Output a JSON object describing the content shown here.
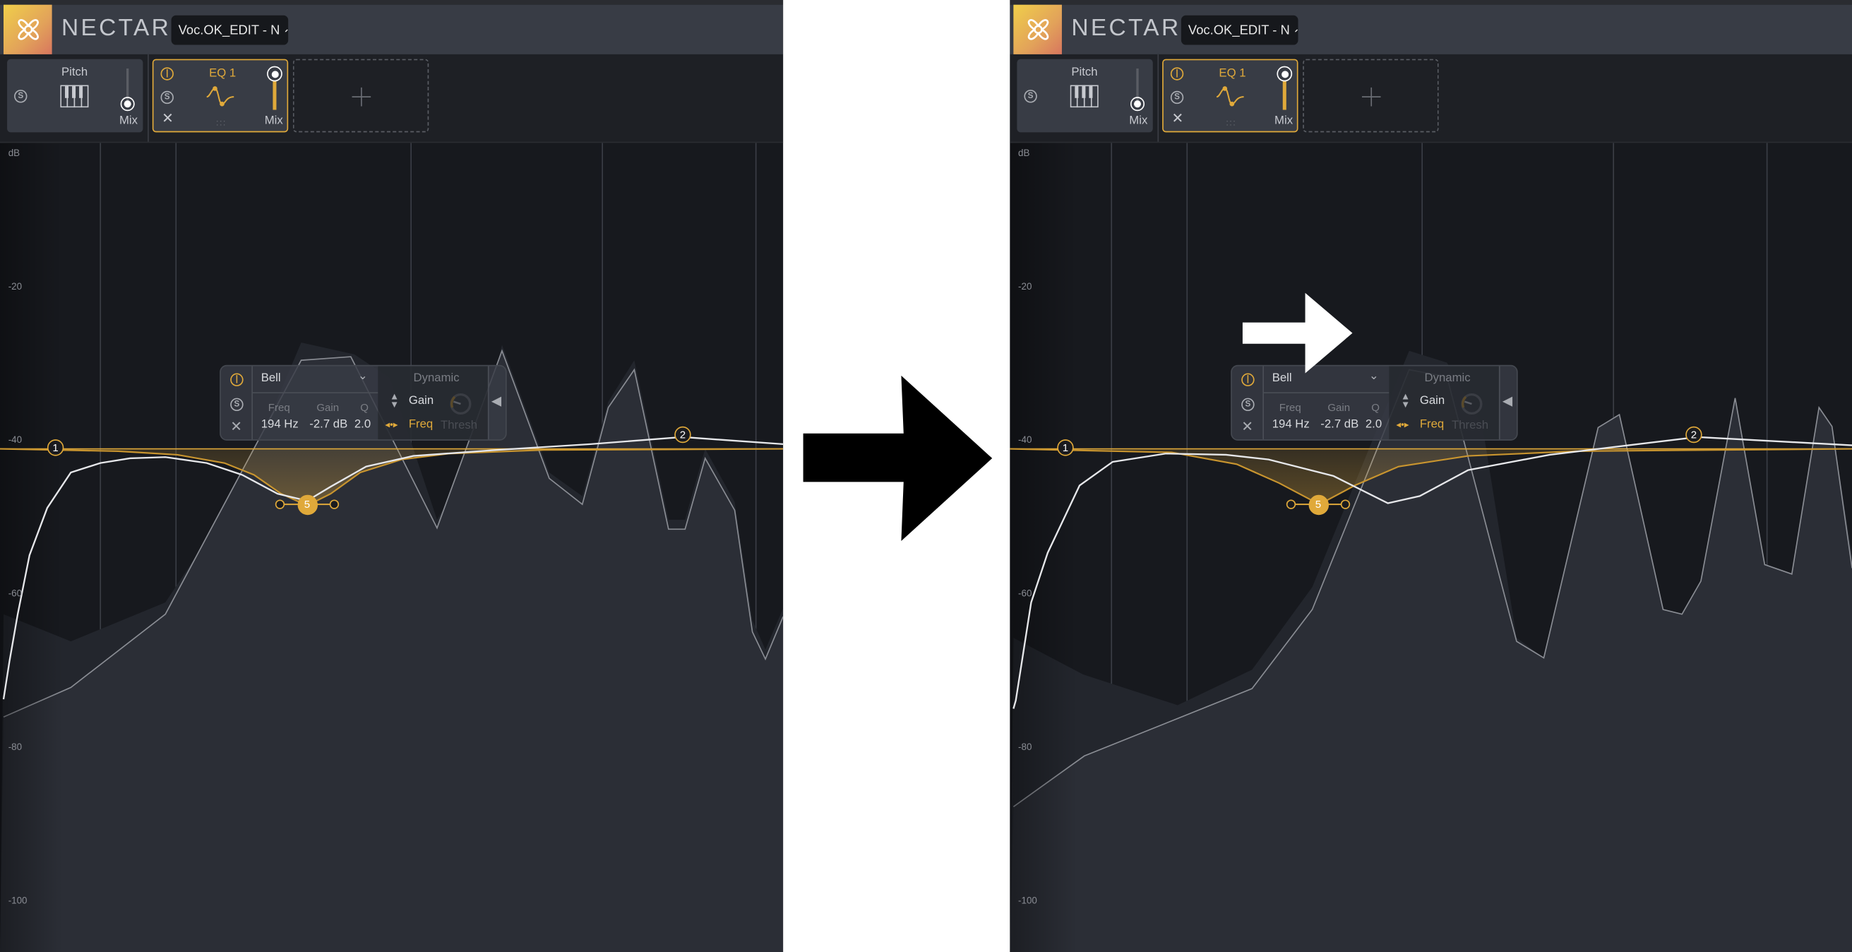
{
  "panels": [
    {
      "state": "before",
      "app": {
        "brand": "NECTAR",
        "preset_name": "Voc.OK_EDIT - N",
        "edit_icon": "pencil-icon",
        "logo_icon": "nectar-flower-logo"
      },
      "modules": [
        {
          "name": "Pitch",
          "mix_label": "Mix",
          "solo_label": "S",
          "icon": "piano-keys-icon",
          "mix_level": 0
        },
        {
          "name": "EQ 1",
          "mix_label": "Mix",
          "solo_label": "S",
          "icon": "eq-curve-icon",
          "mix_level": 1,
          "selected": true
        }
      ],
      "add_module_icon": "plus-icon",
      "db_labels": [
        "dB",
        "-20",
        "-40",
        "-60",
        "-80",
        "-100"
      ],
      "nodes": [
        "1",
        "2",
        "5"
      ],
      "band_popup": {
        "shape": "Bell",
        "freq_label": "Freq",
        "gain_label": "Gain",
        "q_label": "Q",
        "freq_value": "194 Hz",
        "gain_value": "-2.7 dB",
        "q_value": "2.0",
        "dynamic_label": "Dynamic",
        "dyn_gain_label": "Gain",
        "dyn_freq_label": "Freq",
        "thresh_label": "Thresh",
        "solo_label": "S"
      }
    },
    {
      "state": "after",
      "app": {
        "brand": "NECTAR",
        "preset_name": "Voc.OK_EDIT - N",
        "edit_icon": "pencil-icon",
        "logo_icon": "nectar-flower-logo"
      },
      "modules": [
        {
          "name": "Pitch",
          "mix_label": "Mix",
          "solo_label": "S",
          "icon": "piano-keys-icon",
          "mix_level": 0
        },
        {
          "name": "EQ 1",
          "mix_label": "Mix",
          "solo_label": "S",
          "icon": "eq-curve-icon",
          "mix_level": 1,
          "selected": true
        }
      ],
      "add_module_icon": "plus-icon",
      "db_labels": [
        "dB",
        "-20",
        "-40",
        "-60",
        "-80",
        "-100"
      ],
      "nodes": [
        "1",
        "2",
        "5"
      ],
      "band_popup": {
        "shape": "Bell",
        "freq_label": "Freq",
        "gain_label": "Gain",
        "q_label": "Q",
        "freq_value": "194 Hz",
        "gain_value": "-2.7 dB",
        "q_value": "2.0",
        "dynamic_label": "Dynamic",
        "dyn_gain_label": "Gain",
        "dyn_freq_label": "Freq",
        "thresh_label": "Thresh",
        "solo_label": "S"
      }
    }
  ],
  "transition_arrow_icon": "arrow-right-icon",
  "annotation_arrow_icon": "arrow-right-icon",
  "colors": {
    "accent": "#e0a93a",
    "background": "#17191e",
    "header": "#383c45",
    "spectrum": "#2b2e36"
  }
}
